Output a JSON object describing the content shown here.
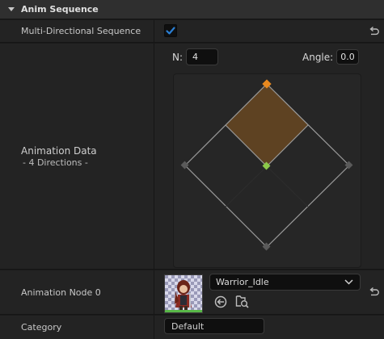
{
  "section": {
    "title": "Anim Sequence"
  },
  "multi_directional": {
    "label": "Multi-Directional Sequence",
    "checked": true
  },
  "animation_data": {
    "label": "Animation Data",
    "sublabel": "- 4 Directions -",
    "n_label": "N:",
    "n_value": "4",
    "angle_label": "Angle:",
    "angle_value": "0.0"
  },
  "animation_node": {
    "label": "Animation Node 0",
    "value": "Warrior_Idle"
  },
  "category": {
    "label": "Category",
    "value": "Default"
  },
  "colors": {
    "selected_fill": "#5e4222",
    "top_vertex": "#e8891f",
    "center_point": "#8cc84a",
    "checkbox_tick": "#2a7fd4"
  },
  "icons": [
    "caret-down-icon",
    "checkmark-icon",
    "reset-arrow-icon",
    "chevron-down-icon",
    "use-selected-icon",
    "browse-asset-icon"
  ]
}
